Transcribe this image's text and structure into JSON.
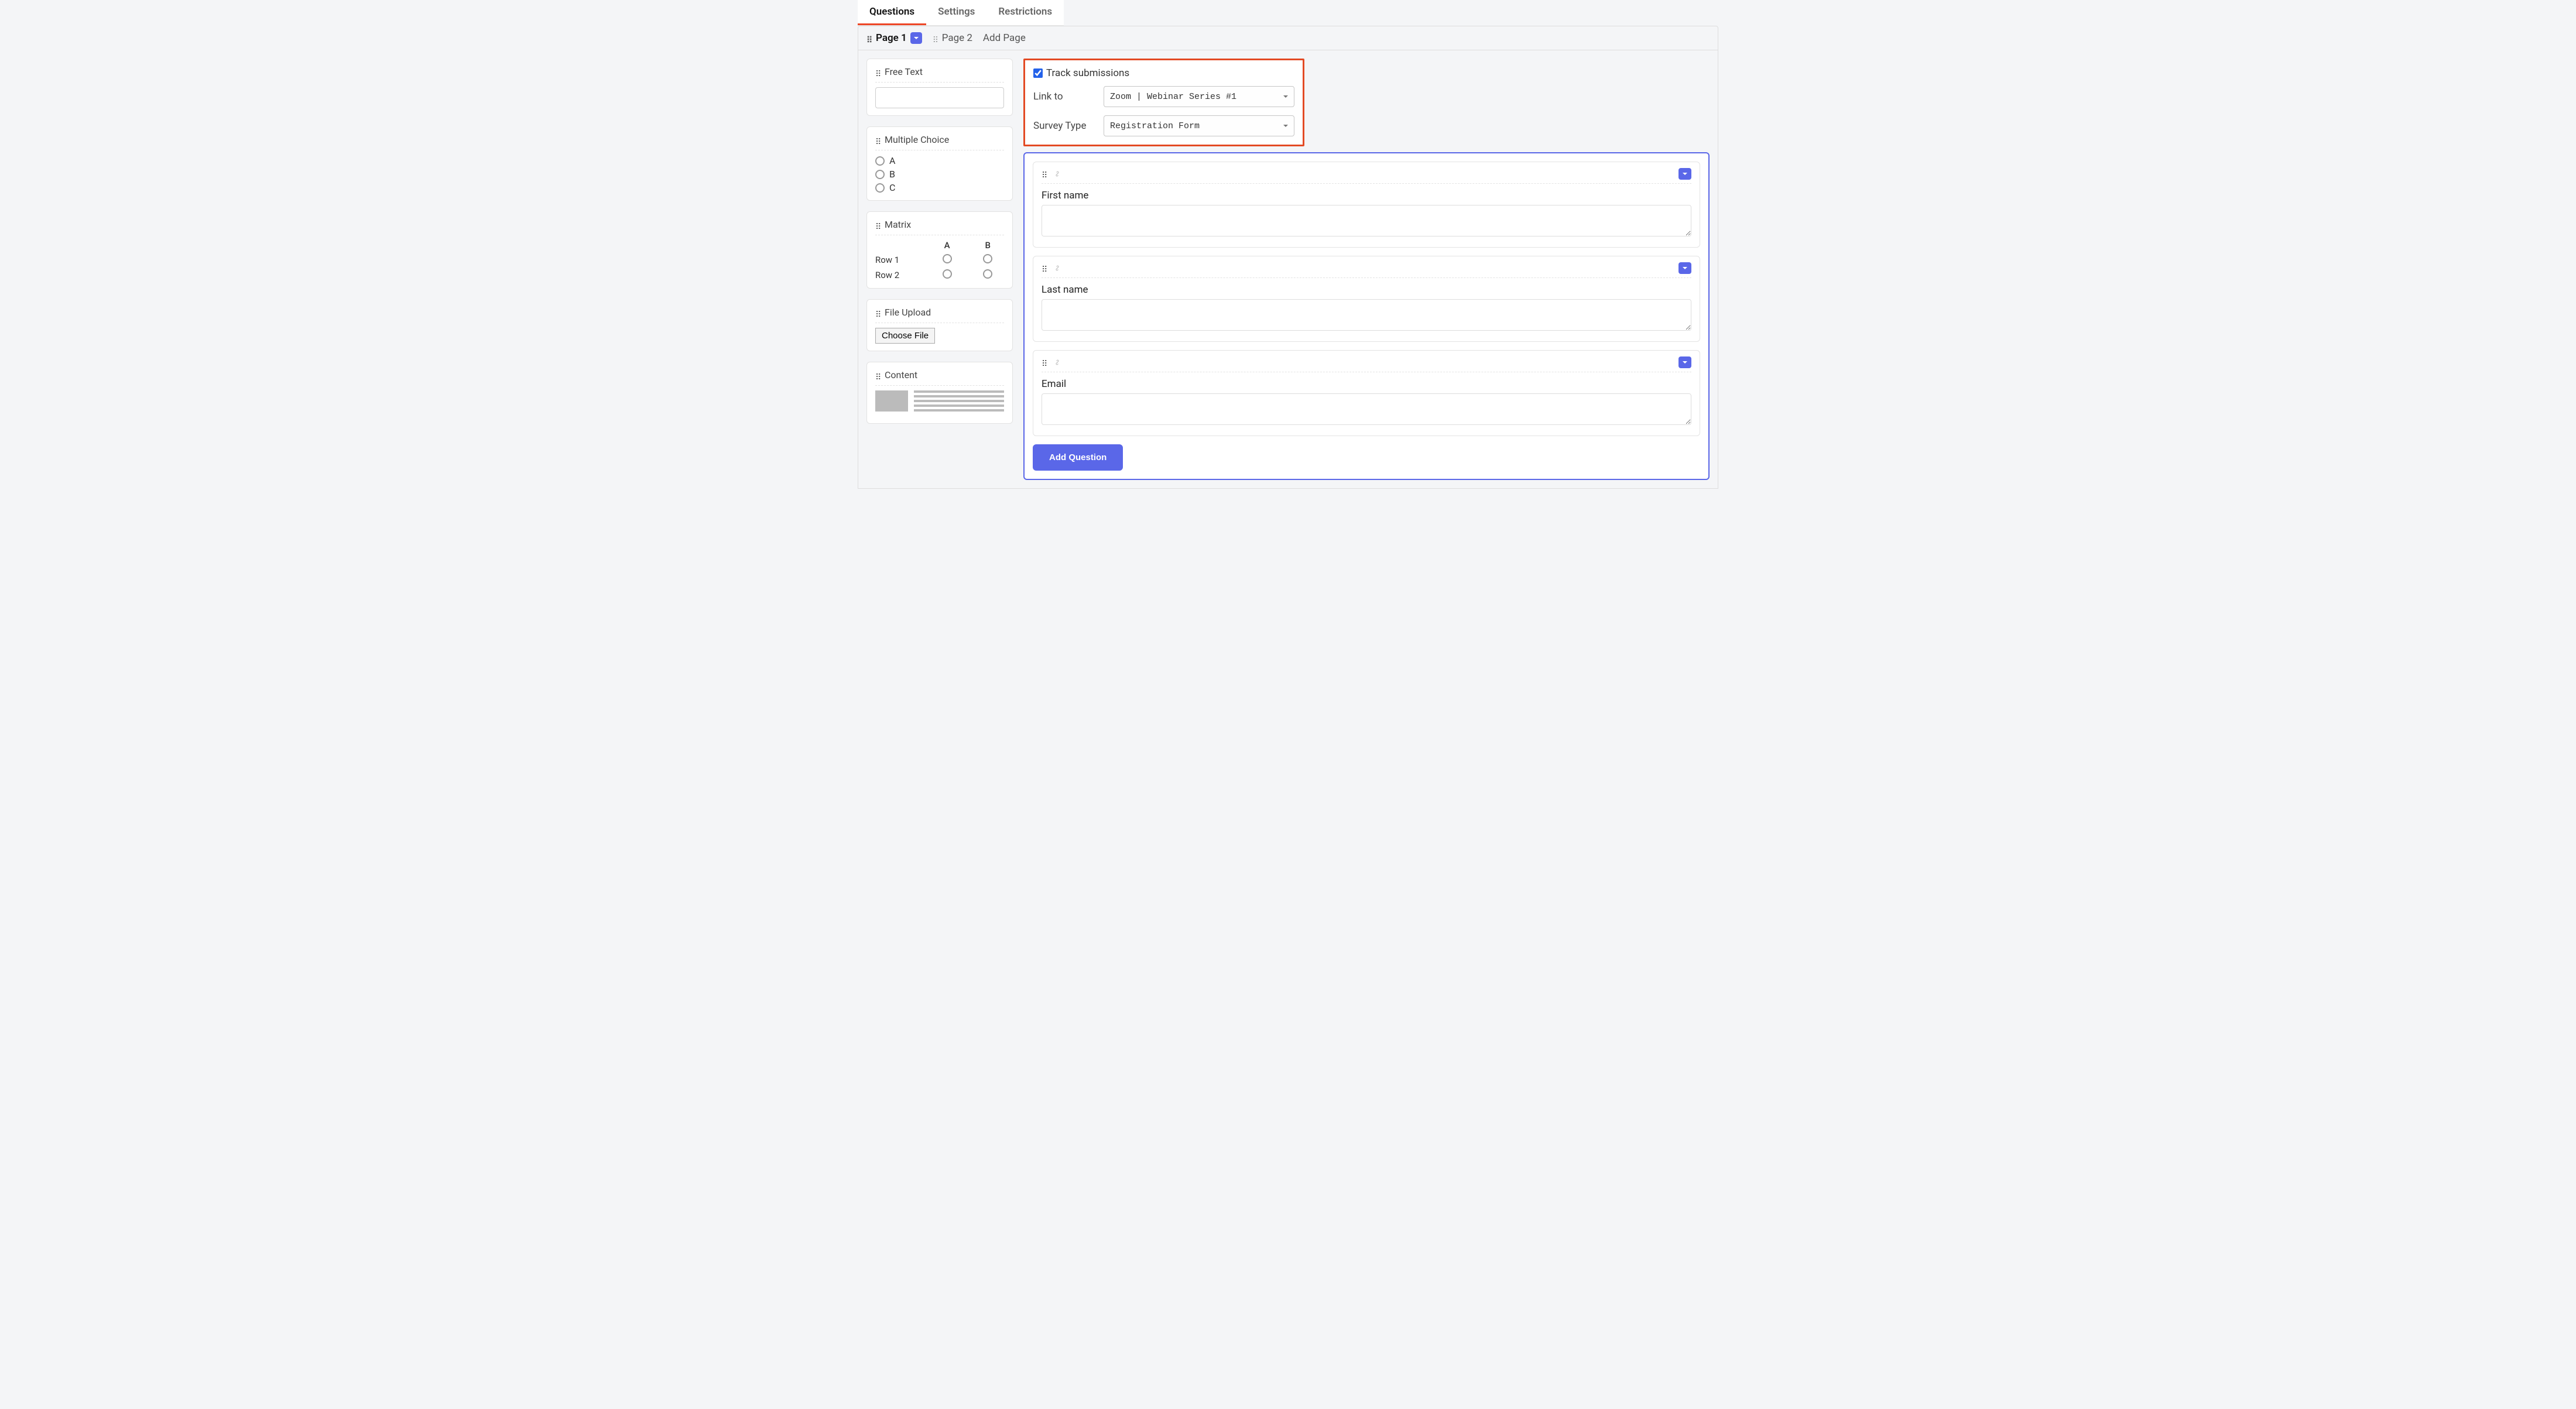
{
  "tabs": {
    "questions": "Questions",
    "settings": "Settings",
    "restrictions": "Restrictions"
  },
  "pages": {
    "page1": "Page 1",
    "page2": "Page 2",
    "add_page": "Add Page"
  },
  "sidebar": {
    "free_text": {
      "title": "Free Text"
    },
    "multiple_choice": {
      "title": "Multiple Choice",
      "options": [
        "A",
        "B",
        "C"
      ]
    },
    "matrix": {
      "title": "Matrix",
      "cols": [
        "A",
        "B"
      ],
      "rows": [
        "Row 1",
        "Row 2"
      ]
    },
    "file_upload": {
      "title": "File Upload",
      "button": "Choose File"
    },
    "content": {
      "title": "Content"
    }
  },
  "settings_box": {
    "track_label": "Track submissions",
    "track_checked": true,
    "link_to_label": "Link to",
    "link_to_value": "Zoom | Webinar Series #1",
    "survey_type_label": "Survey Type",
    "survey_type_value": "Registration Form"
  },
  "questions": [
    {
      "label": "First name",
      "value": ""
    },
    {
      "label": "Last name",
      "value": ""
    },
    {
      "label": "Email",
      "value": ""
    }
  ],
  "buttons": {
    "add_question": "Add Question"
  }
}
